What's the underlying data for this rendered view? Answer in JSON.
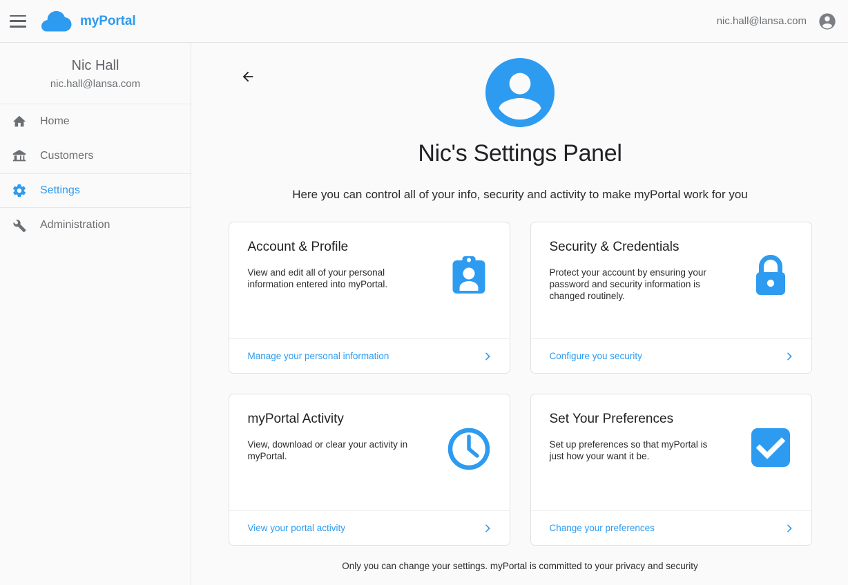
{
  "topbar": {
    "menu_icon": "hamburger-icon",
    "logo_icon": "cloud-icon",
    "brand": "myPortal",
    "email": "nic.hall@lansa.com",
    "account_icon": "account-circle-icon"
  },
  "sidebar": {
    "profile": {
      "name": "Nic Hall",
      "email": "nic.hall@lansa.com"
    },
    "items": [
      {
        "label": "Home",
        "icon": "home-icon",
        "active": false
      },
      {
        "label": "Customers",
        "icon": "bank-icon",
        "active": false
      },
      {
        "label": "Settings",
        "icon": "gear-icon",
        "active": true
      },
      {
        "label": "Administration",
        "icon": "wrench-icon",
        "active": false
      }
    ]
  },
  "main": {
    "back_icon": "arrow-left-icon",
    "avatar_icon": "account-circle-icon",
    "title": "Nic's Settings Panel",
    "subtitle": "Here you can control all of your info, security and activity to make myPortal work for you",
    "footnote": "Only you can change your settings. myPortal is committed to your privacy and security",
    "cards": [
      {
        "title": "Account & Profile",
        "description": "View and edit all of your personal information entered into myPortal.",
        "icon": "id-badge-icon",
        "link": "Manage your personal information",
        "chevron_icon": "chevron-right-icon"
      },
      {
        "title": "Security & Credentials",
        "description": "Protect your account by ensuring your password and security information is changed routinely.",
        "icon": "lock-icon",
        "link": "Configure you security",
        "chevron_icon": "chevron-right-icon"
      },
      {
        "title": "myPortal Activity",
        "description": "View, download or clear your activity in myPortal.",
        "icon": "clock-icon",
        "link": "View your portal activity",
        "chevron_icon": "chevron-right-icon"
      },
      {
        "title": "Set Your Preferences",
        "description": "Set up preferences so that myPortal is just how your want it be.",
        "icon": "checkbox-checked-icon",
        "link": "Change your preferences",
        "chevron_icon": "chevron-right-icon"
      }
    ]
  },
  "colors": {
    "accent_blue": "#2d9bf0",
    "page_bg": "#fafafa",
    "card_bg": "#ffffff",
    "border": "#e2e2e2",
    "text_gray": "#6b6f73",
    "text_dark": "#202124"
  }
}
